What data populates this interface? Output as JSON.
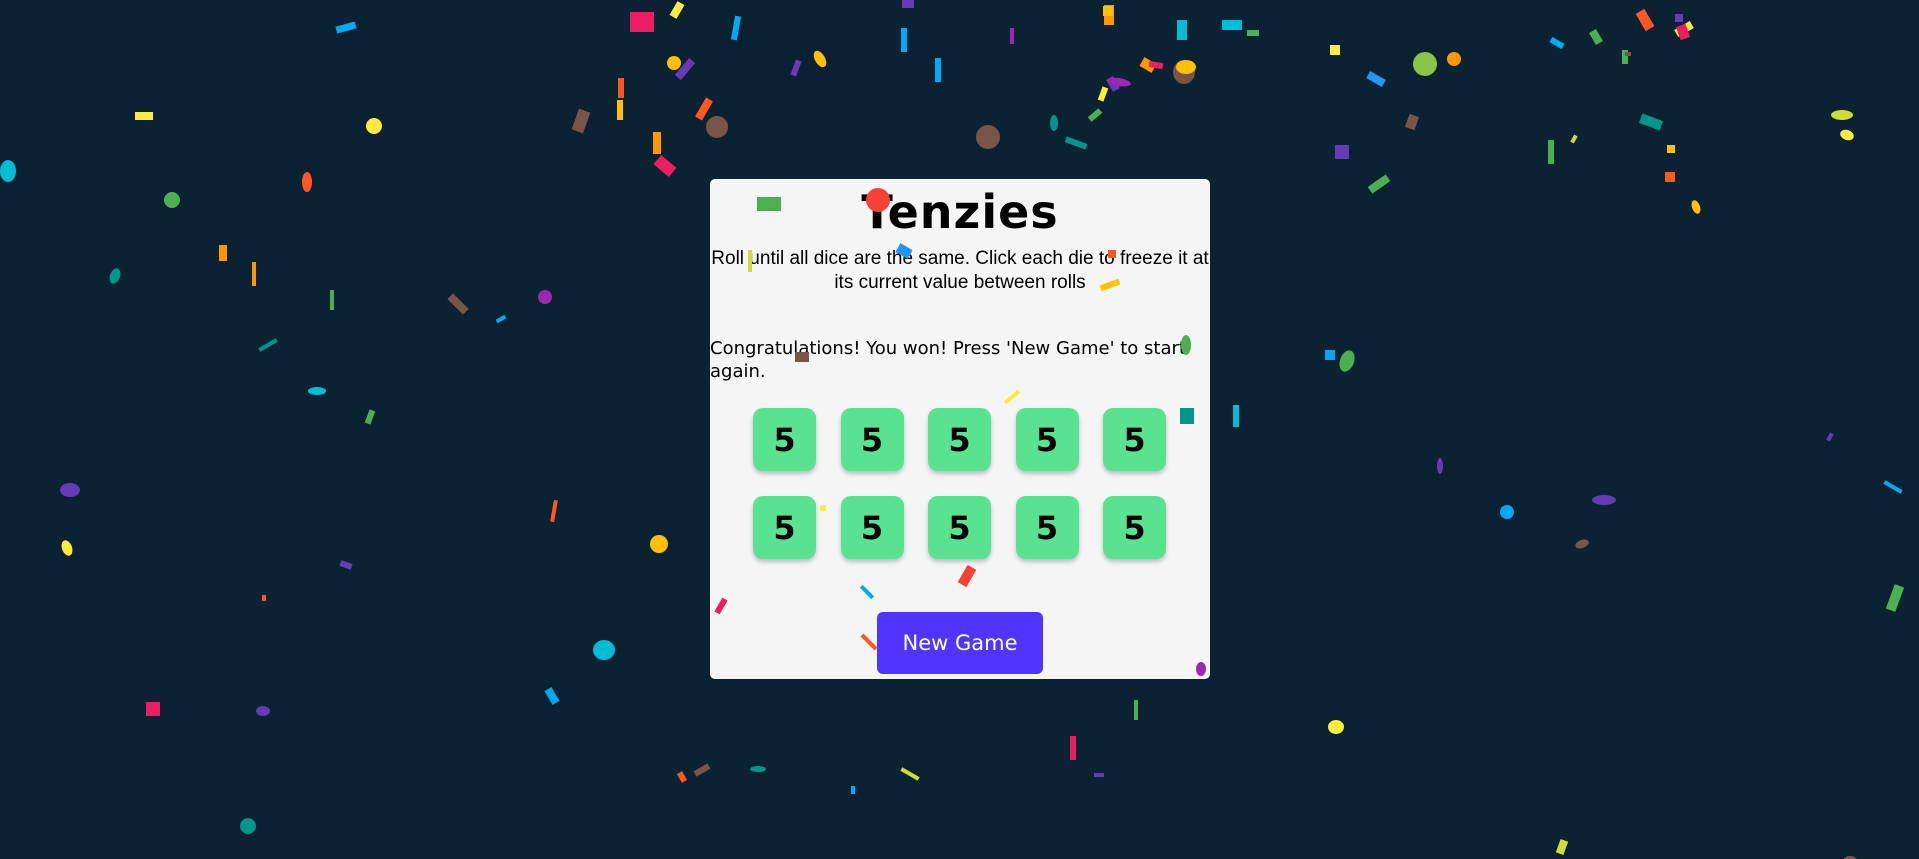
{
  "game": {
    "title": "Tenzies",
    "instructions": "Roll until all dice are the same. Click each die to freeze it at its current value between rolls",
    "win_message": "Congratulations! You won! Press 'New Game' to start again.",
    "button_label": "New Game",
    "dice": [
      "5",
      "5",
      "5",
      "5",
      "5",
      "5",
      "5",
      "5",
      "5",
      "5"
    ],
    "all_dice_held": true,
    "game_won": true
  },
  "colors": {
    "background": "#0b2233",
    "panel": "#f5f5f5",
    "die_held": "#59e391",
    "button": "#5035ff"
  },
  "confetti": {
    "active": true,
    "palette": [
      "#e91e63",
      "#03a9f4",
      "#ffeb3b",
      "#ff9800",
      "#4caf50",
      "#9c27b0",
      "#795548",
      "#00bcd4",
      "#673ab7",
      "#f44336",
      "#8bc34a",
      "#009688",
      "#2196f3",
      "#cddc39",
      "#ffc107",
      "#ff5722"
    ]
  }
}
